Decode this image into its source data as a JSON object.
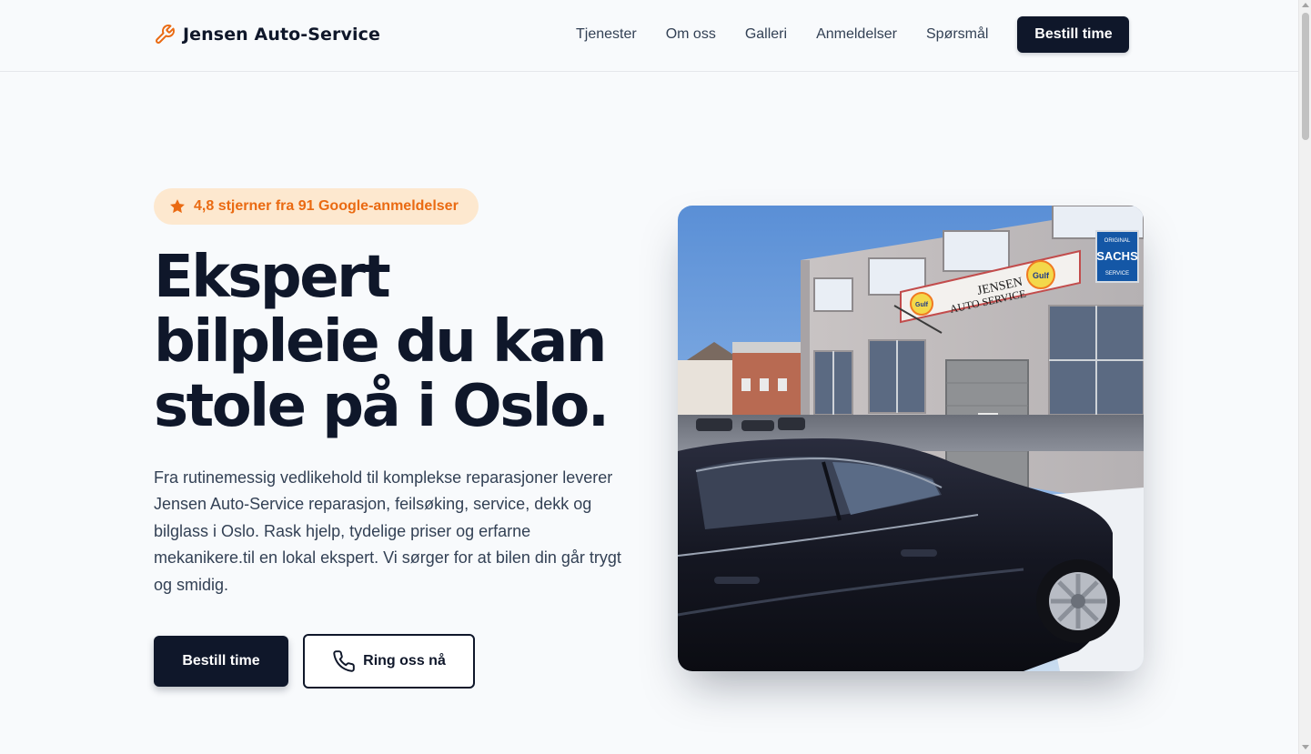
{
  "header": {
    "brand": "Jensen Auto-Service",
    "brand_icon": "wrench-icon",
    "nav": [
      {
        "label": "Tjenester"
      },
      {
        "label": "Om oss"
      },
      {
        "label": "Galleri"
      },
      {
        "label": "Anmeldelser"
      },
      {
        "label": "Spørsmål"
      }
    ],
    "cta_label": "Bestill time"
  },
  "hero": {
    "badge_icon": "star-icon",
    "badge_text": "4,8 stjerner fra 91 Google-anmeldelser",
    "headline_lines": [
      "Ekspert",
      "bilpleie du kan",
      "stole på i Oslo."
    ],
    "description": "Fra rutinemessig vedlikehold til komplekse reparasjoner leverer Jensen Auto-Service reparasjon, feilsøking, service, dekk og bilglass i Oslo. Rask hjelp, tydelige priser og erfarne mekanikere.til en lokal ekspert. Vi sørger for at bilen din går trygt og smidig.",
    "primary_button": "Bestill time",
    "secondary_button": "Ring oss nå",
    "secondary_icon": "phone-icon",
    "image": {
      "sign_line1": "JENSEN",
      "sign_line2": "AUTO SERVICE",
      "sign_brand": "Gulf",
      "side_sign_top": "ORIGINAL",
      "side_sign_main": "SACHS",
      "side_sign_bottom": "SERVICE"
    }
  },
  "colors": {
    "primary": "#0f172a",
    "accent": "#ea6a12",
    "badge_bg": "#fde8cf",
    "page_bg": "#f8fafc"
  }
}
